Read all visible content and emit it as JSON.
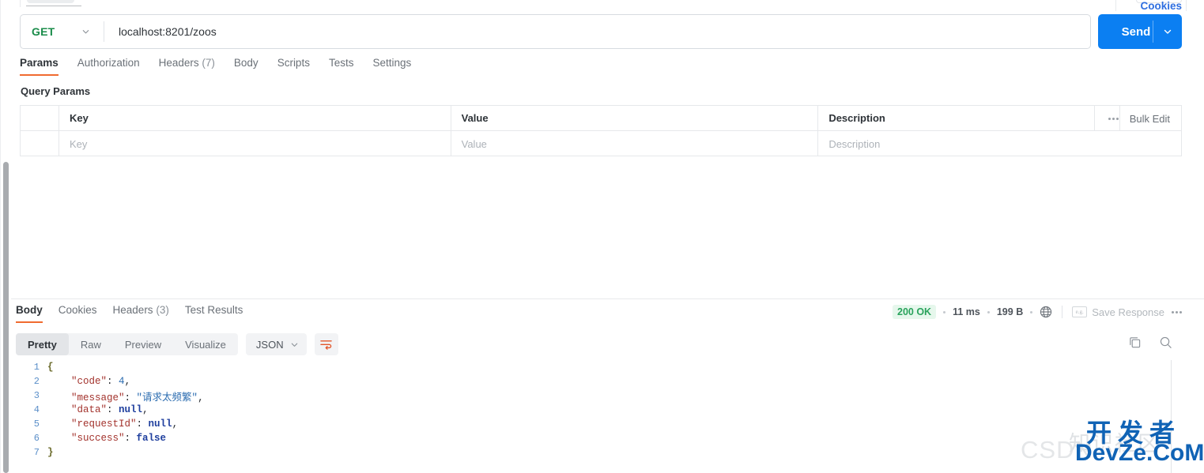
{
  "request": {
    "method": "GET",
    "url": "localhost:8201/zoos",
    "send_label": "Send",
    "tabs": [
      {
        "label": "Params",
        "count": "",
        "active": true
      },
      {
        "label": "Authorization",
        "count": "",
        "active": false
      },
      {
        "label": "Headers",
        "count": "(7)",
        "active": false
      },
      {
        "label": "Body",
        "count": "",
        "active": false
      },
      {
        "label": "Scripts",
        "count": "",
        "active": false
      },
      {
        "label": "Tests",
        "count": "",
        "active": false
      },
      {
        "label": "Settings",
        "count": "",
        "active": false
      }
    ],
    "cookies_label": "Cookies",
    "query_params": {
      "section_title": "Query Params",
      "columns": [
        "Key",
        "Value",
        "Description"
      ],
      "rows": [
        {
          "key": "Key",
          "value": "Value",
          "description": "Description"
        }
      ],
      "bulk_edit_label": "Bulk Edit",
      "more_icon": "ellipsis-horizontal-icon"
    }
  },
  "response": {
    "tabs": [
      {
        "label": "Body",
        "count": "",
        "active": true
      },
      {
        "label": "Cookies",
        "count": "",
        "active": false
      },
      {
        "label": "Headers",
        "count": "(3)",
        "active": false
      },
      {
        "label": "Test Results",
        "count": "",
        "active": false
      }
    ],
    "status": {
      "code": "200 OK",
      "time": "11 ms",
      "size": "199 B",
      "globe_icon": "globe-icon",
      "save_response_label": "Save Response",
      "save_icon": "example-icon",
      "more_icon": "ellipsis-horizontal-icon"
    },
    "view_modes": [
      {
        "label": "Pretty",
        "active": true
      },
      {
        "label": "Raw",
        "active": false
      },
      {
        "label": "Preview",
        "active": false
      },
      {
        "label": "Visualize",
        "active": false
      }
    ],
    "format": "JSON",
    "wrap_icon": "wrap-lines-icon",
    "copy_icon": "copy-icon",
    "search_icon": "search-icon",
    "body_lines": [
      {
        "no": "1",
        "indent": 0,
        "tokens": [
          {
            "t": "{",
            "c": "k-brace"
          }
        ]
      },
      {
        "no": "2",
        "indent": 1,
        "tokens": [
          {
            "t": "\"code\"",
            "c": "k-key"
          },
          {
            "t": ": ",
            "c": "k-punct"
          },
          {
            "t": "4",
            "c": "k-num"
          },
          {
            "t": ",",
            "c": "k-punct"
          }
        ]
      },
      {
        "no": "3",
        "indent": 1,
        "tokens": [
          {
            "t": "\"message\"",
            "c": "k-key"
          },
          {
            "t": ": ",
            "c": "k-punct"
          },
          {
            "t": "\"请求太频繁\"",
            "c": "k-str"
          },
          {
            "t": ",",
            "c": "k-punct"
          }
        ]
      },
      {
        "no": "4",
        "indent": 1,
        "tokens": [
          {
            "t": "\"data\"",
            "c": "k-key"
          },
          {
            "t": ": ",
            "c": "k-punct"
          },
          {
            "t": "null",
            "c": "k-lit"
          },
          {
            "t": ",",
            "c": "k-punct"
          }
        ]
      },
      {
        "no": "5",
        "indent": 1,
        "tokens": [
          {
            "t": "\"requestId\"",
            "c": "k-key"
          },
          {
            "t": ": ",
            "c": "k-punct"
          },
          {
            "t": "null",
            "c": "k-lit"
          },
          {
            "t": ",",
            "c": "k-punct"
          }
        ]
      },
      {
        "no": "6",
        "indent": 1,
        "tokens": [
          {
            "t": "\"success\"",
            "c": "k-key"
          },
          {
            "t": ": ",
            "c": "k-punct"
          },
          {
            "t": "false",
            "c": "k-lit"
          }
        ]
      },
      {
        "no": "7",
        "indent": 0,
        "tokens": [
          {
            "t": "}",
            "c": "k-brace"
          }
        ]
      }
    ]
  },
  "watermark": {
    "csdn": "CSDN",
    "chinese": "开发者",
    "english": "DevZe.CoM",
    "ghost": "知识社区"
  },
  "colors": {
    "accent_orange": "#f06b30",
    "send_blue": "#0b7ff2",
    "method_green": "#1a8c4a",
    "status_green": "#2aa35c",
    "link_blue": "#2f6fe0",
    "watermark_blue": "#1063b5"
  }
}
